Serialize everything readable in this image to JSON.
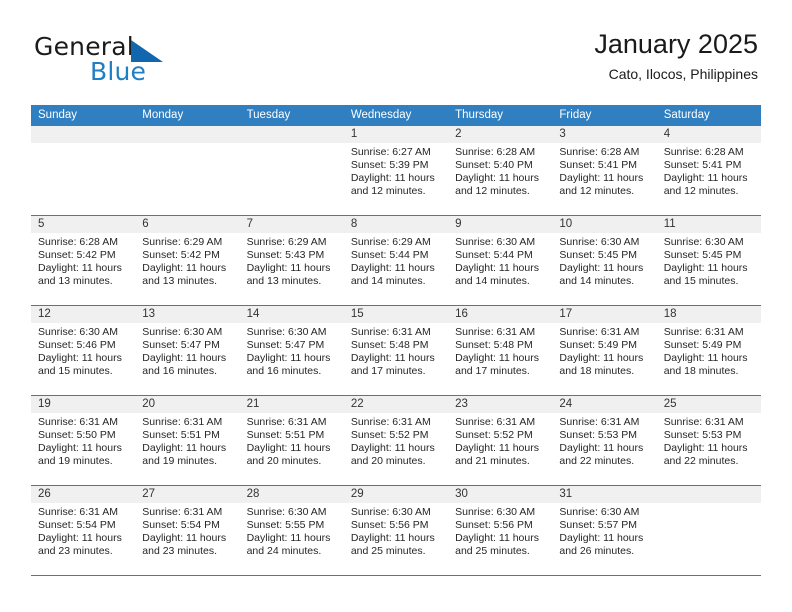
{
  "brand": {
    "name_part1": "General",
    "name_part2": "Blue",
    "logo_color": "#1266ad",
    "text_color": "#1f7fc4"
  },
  "header": {
    "title": "January 2025",
    "subtitle": "Cato, Ilocos, Philippines"
  },
  "theme": {
    "header_blue": "#2f7fc1",
    "day_band_gray": "#f0f0f0"
  },
  "weekdays": [
    "Sunday",
    "Monday",
    "Tuesday",
    "Wednesday",
    "Thursday",
    "Friday",
    "Saturday"
  ],
  "labels": {
    "sunrise_prefix": "Sunrise:",
    "sunset_prefix": "Sunset:",
    "daylight_prefix": "Daylight:"
  },
  "weeks": [
    [
      {
        "day": "",
        "sunrise": "",
        "sunset": "",
        "daylight_line1": "",
        "daylight_line2": ""
      },
      {
        "day": "",
        "sunrise": "",
        "sunset": "",
        "daylight_line1": "",
        "daylight_line2": ""
      },
      {
        "day": "",
        "sunrise": "",
        "sunset": "",
        "daylight_line1": "",
        "daylight_line2": ""
      },
      {
        "day": "1",
        "sunrise": "Sunrise: 6:27 AM",
        "sunset": "Sunset: 5:39 PM",
        "daylight_line1": "Daylight: 11 hours",
        "daylight_line2": "and 12 minutes."
      },
      {
        "day": "2",
        "sunrise": "Sunrise: 6:28 AM",
        "sunset": "Sunset: 5:40 PM",
        "daylight_line1": "Daylight: 11 hours",
        "daylight_line2": "and 12 minutes."
      },
      {
        "day": "3",
        "sunrise": "Sunrise: 6:28 AM",
        "sunset": "Sunset: 5:41 PM",
        "daylight_line1": "Daylight: 11 hours",
        "daylight_line2": "and 12 minutes."
      },
      {
        "day": "4",
        "sunrise": "Sunrise: 6:28 AM",
        "sunset": "Sunset: 5:41 PM",
        "daylight_line1": "Daylight: 11 hours",
        "daylight_line2": "and 12 minutes."
      }
    ],
    [
      {
        "day": "5",
        "sunrise": "Sunrise: 6:28 AM",
        "sunset": "Sunset: 5:42 PM",
        "daylight_line1": "Daylight: 11 hours",
        "daylight_line2": "and 13 minutes."
      },
      {
        "day": "6",
        "sunrise": "Sunrise: 6:29 AM",
        "sunset": "Sunset: 5:42 PM",
        "daylight_line1": "Daylight: 11 hours",
        "daylight_line2": "and 13 minutes."
      },
      {
        "day": "7",
        "sunrise": "Sunrise: 6:29 AM",
        "sunset": "Sunset: 5:43 PM",
        "daylight_line1": "Daylight: 11 hours",
        "daylight_line2": "and 13 minutes."
      },
      {
        "day": "8",
        "sunrise": "Sunrise: 6:29 AM",
        "sunset": "Sunset: 5:44 PM",
        "daylight_line1": "Daylight: 11 hours",
        "daylight_line2": "and 14 minutes."
      },
      {
        "day": "9",
        "sunrise": "Sunrise: 6:30 AM",
        "sunset": "Sunset: 5:44 PM",
        "daylight_line1": "Daylight: 11 hours",
        "daylight_line2": "and 14 minutes."
      },
      {
        "day": "10",
        "sunrise": "Sunrise: 6:30 AM",
        "sunset": "Sunset: 5:45 PM",
        "daylight_line1": "Daylight: 11 hours",
        "daylight_line2": "and 14 minutes."
      },
      {
        "day": "11",
        "sunrise": "Sunrise: 6:30 AM",
        "sunset": "Sunset: 5:45 PM",
        "daylight_line1": "Daylight: 11 hours",
        "daylight_line2": "and 15 minutes."
      }
    ],
    [
      {
        "day": "12",
        "sunrise": "Sunrise: 6:30 AM",
        "sunset": "Sunset: 5:46 PM",
        "daylight_line1": "Daylight: 11 hours",
        "daylight_line2": "and 15 minutes."
      },
      {
        "day": "13",
        "sunrise": "Sunrise: 6:30 AM",
        "sunset": "Sunset: 5:47 PM",
        "daylight_line1": "Daylight: 11 hours",
        "daylight_line2": "and 16 minutes."
      },
      {
        "day": "14",
        "sunrise": "Sunrise: 6:30 AM",
        "sunset": "Sunset: 5:47 PM",
        "daylight_line1": "Daylight: 11 hours",
        "daylight_line2": "and 16 minutes."
      },
      {
        "day": "15",
        "sunrise": "Sunrise: 6:31 AM",
        "sunset": "Sunset: 5:48 PM",
        "daylight_line1": "Daylight: 11 hours",
        "daylight_line2": "and 17 minutes."
      },
      {
        "day": "16",
        "sunrise": "Sunrise: 6:31 AM",
        "sunset": "Sunset: 5:48 PM",
        "daylight_line1": "Daylight: 11 hours",
        "daylight_line2": "and 17 minutes."
      },
      {
        "day": "17",
        "sunrise": "Sunrise: 6:31 AM",
        "sunset": "Sunset: 5:49 PM",
        "daylight_line1": "Daylight: 11 hours",
        "daylight_line2": "and 18 minutes."
      },
      {
        "day": "18",
        "sunrise": "Sunrise: 6:31 AM",
        "sunset": "Sunset: 5:49 PM",
        "daylight_line1": "Daylight: 11 hours",
        "daylight_line2": "and 18 minutes."
      }
    ],
    [
      {
        "day": "19",
        "sunrise": "Sunrise: 6:31 AM",
        "sunset": "Sunset: 5:50 PM",
        "daylight_line1": "Daylight: 11 hours",
        "daylight_line2": "and 19 minutes."
      },
      {
        "day": "20",
        "sunrise": "Sunrise: 6:31 AM",
        "sunset": "Sunset: 5:51 PM",
        "daylight_line1": "Daylight: 11 hours",
        "daylight_line2": "and 19 minutes."
      },
      {
        "day": "21",
        "sunrise": "Sunrise: 6:31 AM",
        "sunset": "Sunset: 5:51 PM",
        "daylight_line1": "Daylight: 11 hours",
        "daylight_line2": "and 20 minutes."
      },
      {
        "day": "22",
        "sunrise": "Sunrise: 6:31 AM",
        "sunset": "Sunset: 5:52 PM",
        "daylight_line1": "Daylight: 11 hours",
        "daylight_line2": "and 20 minutes."
      },
      {
        "day": "23",
        "sunrise": "Sunrise: 6:31 AM",
        "sunset": "Sunset: 5:52 PM",
        "daylight_line1": "Daylight: 11 hours",
        "daylight_line2": "and 21 minutes."
      },
      {
        "day": "24",
        "sunrise": "Sunrise: 6:31 AM",
        "sunset": "Sunset: 5:53 PM",
        "daylight_line1": "Daylight: 11 hours",
        "daylight_line2": "and 22 minutes."
      },
      {
        "day": "25",
        "sunrise": "Sunrise: 6:31 AM",
        "sunset": "Sunset: 5:53 PM",
        "daylight_line1": "Daylight: 11 hours",
        "daylight_line2": "and 22 minutes."
      }
    ],
    [
      {
        "day": "26",
        "sunrise": "Sunrise: 6:31 AM",
        "sunset": "Sunset: 5:54 PM",
        "daylight_line1": "Daylight: 11 hours",
        "daylight_line2": "and 23 minutes."
      },
      {
        "day": "27",
        "sunrise": "Sunrise: 6:31 AM",
        "sunset": "Sunset: 5:54 PM",
        "daylight_line1": "Daylight: 11 hours",
        "daylight_line2": "and 23 minutes."
      },
      {
        "day": "28",
        "sunrise": "Sunrise: 6:30 AM",
        "sunset": "Sunset: 5:55 PM",
        "daylight_line1": "Daylight: 11 hours",
        "daylight_line2": "and 24 minutes."
      },
      {
        "day": "29",
        "sunrise": "Sunrise: 6:30 AM",
        "sunset": "Sunset: 5:56 PM",
        "daylight_line1": "Daylight: 11 hours",
        "daylight_line2": "and 25 minutes."
      },
      {
        "day": "30",
        "sunrise": "Sunrise: 6:30 AM",
        "sunset": "Sunset: 5:56 PM",
        "daylight_line1": "Daylight: 11 hours",
        "daylight_line2": "and 25 minutes."
      },
      {
        "day": "31",
        "sunrise": "Sunrise: 6:30 AM",
        "sunset": "Sunset: 5:57 PM",
        "daylight_line1": "Daylight: 11 hours",
        "daylight_line2": "and 26 minutes."
      },
      {
        "day": "",
        "sunrise": "",
        "sunset": "",
        "daylight_line1": "",
        "daylight_line2": ""
      }
    ]
  ]
}
